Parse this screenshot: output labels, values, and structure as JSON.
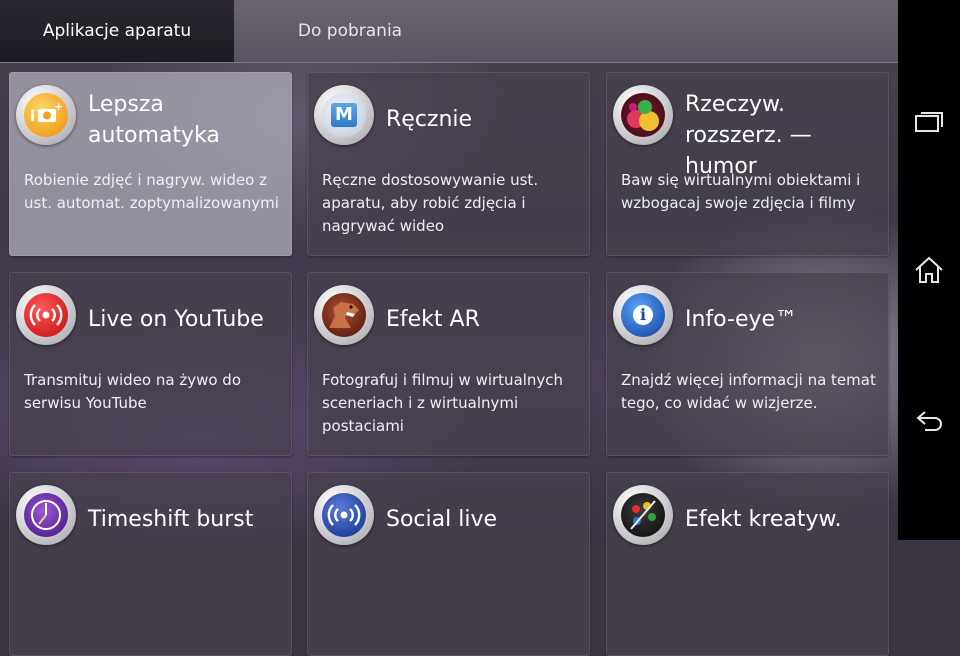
{
  "tabs": [
    {
      "label": "Aplikacje aparatu",
      "active": true
    },
    {
      "label": "Do pobrania",
      "active": false
    }
  ],
  "apps": [
    {
      "title": "Lepsza automatyka",
      "description": "Robienie zdjęć i nagryw. wideo z ust. automat. zoptymalizowanymi",
      "icon": "camera-plus-icon",
      "selected": true
    },
    {
      "title": "Ręcznie",
      "description": "Ręczne dostosowywanie ust. aparatu, aby robić zdjęcia i nagrywać wideo",
      "icon": "manual-m-icon",
      "selected": false
    },
    {
      "title": "Rzeczyw. rozszerz. — humor",
      "description": "Baw się wirtualnymi obiektami i wzbogacaj swoje zdjęcia i filmy",
      "icon": "ar-fun-bubbles-icon",
      "selected": false
    },
    {
      "title": "Live on YouTube",
      "description": "Transmituj wideo na żywo do serwisu YouTube",
      "icon": "live-broadcast-icon",
      "selected": false
    },
    {
      "title": "Efekt AR",
      "description": "Fotografuj i filmuj w wirtualnych sceneriach i z wirtualnymi postaciami",
      "icon": "dinosaur-icon",
      "selected": false
    },
    {
      "title": "Info-eye™",
      "description": "Znajdź więcej informacji na temat tego, co widać w wizjerze.",
      "icon": "info-eye-icon",
      "selected": false
    },
    {
      "title": "Timeshift burst",
      "description": "",
      "icon": "timeshift-clock-icon",
      "selected": false
    },
    {
      "title": "Social live",
      "description": "",
      "icon": "social-live-broadcast-icon",
      "selected": false
    },
    {
      "title": "Efekt kreatyw.",
      "description": "",
      "icon": "creative-palette-icon",
      "selected": false
    }
  ],
  "nav": [
    "recent-apps-icon",
    "home-icon",
    "back-icon"
  ]
}
